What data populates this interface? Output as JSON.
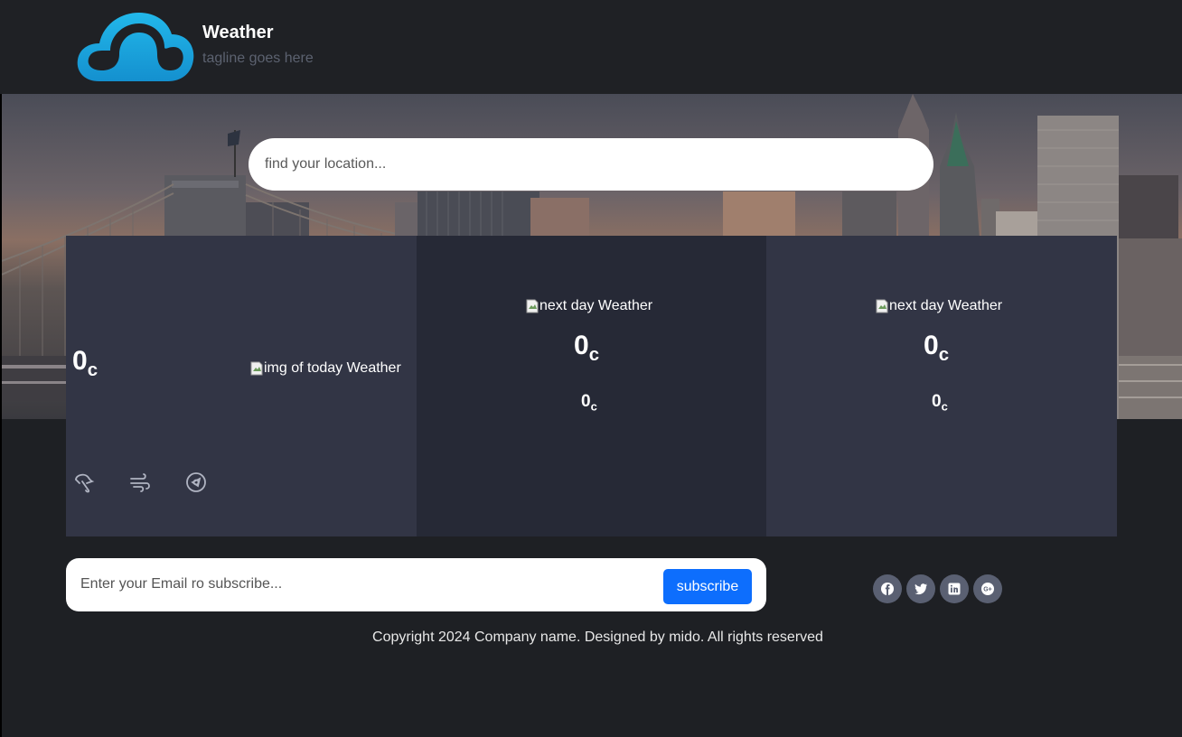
{
  "header": {
    "title": "Weather",
    "tagline": "tagline goes here",
    "logo_icon": "cloud-icon",
    "logo_color": "#1fa8e0"
  },
  "search": {
    "placeholder": "find your location..."
  },
  "forecast": {
    "today": {
      "temp": "0",
      "unit": "c",
      "img_alt": "img of today Weather",
      "icons": [
        "umbrella-icon",
        "wind-icon",
        "compass-icon"
      ]
    },
    "day2": {
      "img_alt": "next day Weather",
      "max_temp": "0",
      "max_unit": "c",
      "min_temp": "0",
      "min_unit": "c"
    },
    "day3": {
      "img_alt": "next day Weather",
      "max_temp": "0",
      "max_unit": "c",
      "min_temp": "0",
      "min_unit": "c"
    }
  },
  "subscribe": {
    "placeholder": "Enter your Email ro subscribe...",
    "button_label": "subscribe",
    "button_color": "#0d6efd"
  },
  "socials": [
    "facebook-icon",
    "twitter-icon",
    "linkedin-icon",
    "google-plus-icon"
  ],
  "footer": {
    "copyright": "Copyright 2024 Company name. Designed by mido. All rights reserved"
  }
}
